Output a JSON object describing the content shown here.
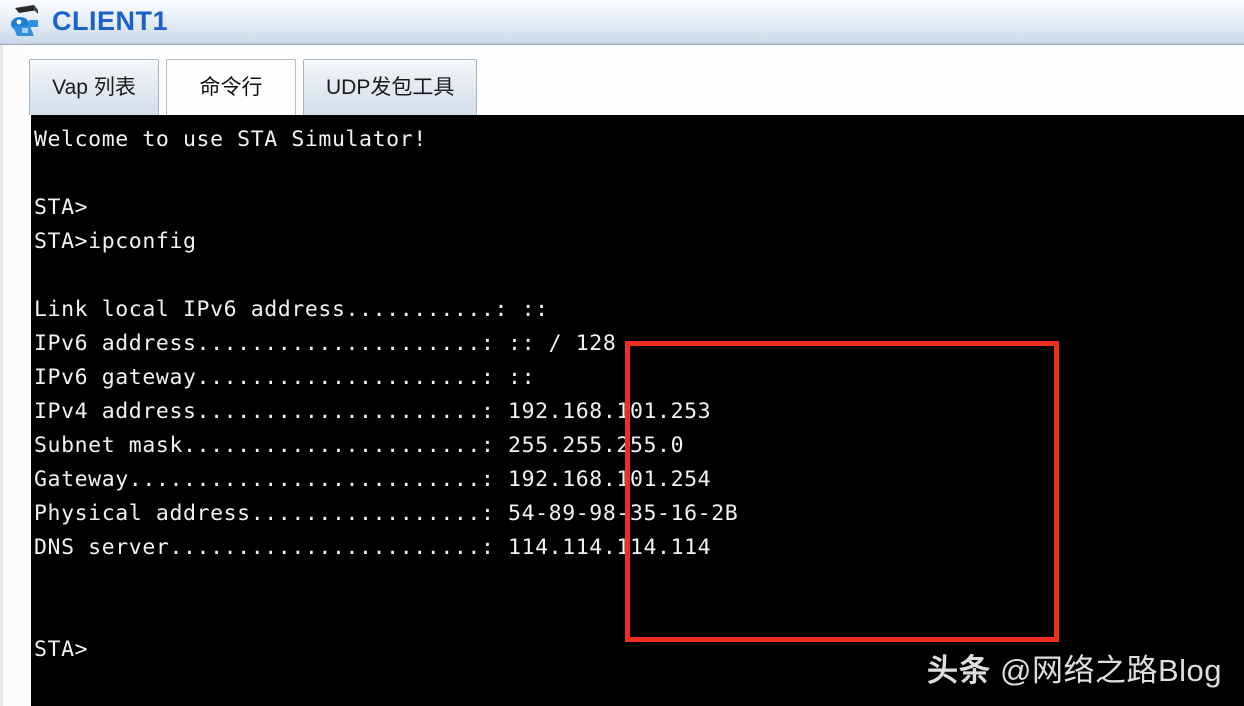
{
  "window": {
    "title": "CLIENT1",
    "icon": "client-device-icon"
  },
  "tabs": [
    {
      "label": "Vap 列表",
      "name": "tab-vap-list",
      "active": false
    },
    {
      "label": "命令行",
      "name": "tab-command-line",
      "active": true
    },
    {
      "label": "UDP发包工具",
      "name": "tab-udp-tool",
      "active": false
    }
  ],
  "terminal": {
    "lines": [
      "Welcome to use STA Simulator!",
      "",
      "STA>",
      "STA>ipconfig",
      "",
      "Link local IPv6 address...........: ::",
      "IPv6 address.....................: :: / 128",
      "IPv6 gateway.....................: ::",
      "IPv4 address.....................: 192.168.101.253",
      "Subnet mask......................: 255.255.255.0",
      "Gateway..........................: 192.168.101.254",
      "Physical address.................: 54-89-98-35-16-2B",
      "DNS server.......................: 114.114.114.114",
      "",
      "",
      "STA>"
    ],
    "prompt": "STA>",
    "command": "ipconfig",
    "banner": "Welcome to use STA Simulator!",
    "fields": [
      {
        "label": "Link local IPv6 address",
        "value": "::"
      },
      {
        "label": "IPv6 address",
        "value": ":: / 128"
      },
      {
        "label": "IPv6 gateway",
        "value": "::"
      },
      {
        "label": "IPv4 address",
        "value": "192.168.101.253"
      },
      {
        "label": "Subnet mask",
        "value": "255.255.255.0"
      },
      {
        "label": "Gateway",
        "value": "192.168.101.254"
      },
      {
        "label": "Physical address",
        "value": "54-89-98-35-16-2B"
      },
      {
        "label": "DNS server",
        "value": "114.114.114.114"
      }
    ]
  },
  "annotation": {
    "type": "red-rectangle-highlight",
    "color": "#ef2d22"
  },
  "watermark": {
    "strong": "头条",
    "rest": "@网络之路Blog"
  },
  "colors": {
    "title_text": "#1a62c8",
    "titlebar_top": "#fbfcfe",
    "titlebar_bottom": "#c3d2e3",
    "terminal_bg": "#000000",
    "terminal_fg": "#f2f2f2",
    "highlight": "#ef2d22"
  }
}
